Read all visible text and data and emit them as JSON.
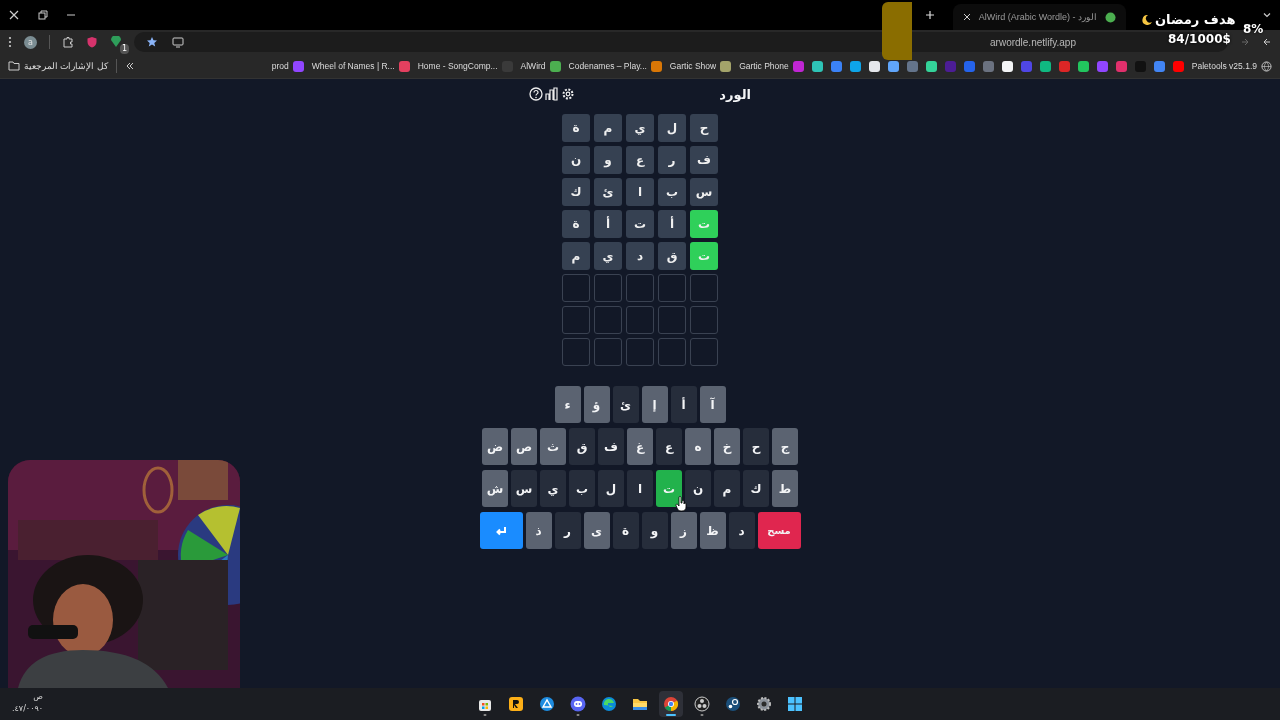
{
  "browser": {
    "tab": {
      "title": "AlWird (Arabic Wordle) - الورد"
    },
    "profile_initial": "a",
    "extension_badge": "1",
    "address": "arwordle.netlify.app",
    "extra_bookmark": "Paletools v25.1.9",
    "icon_bookmarks": [
      {
        "color": "#ff0000"
      },
      {
        "color": "#4285f4"
      },
      {
        "color": "#111111"
      },
      {
        "color": "#e1306c"
      },
      {
        "color": "#9146ff"
      },
      {
        "color": "#22c55e"
      },
      {
        "color": "#dc2626"
      },
      {
        "color": "#10b981"
      },
      {
        "color": "#4f46e5"
      },
      {
        "color": "#f3f4f6"
      },
      {
        "color": "#6b7280"
      },
      {
        "color": "#2563eb"
      },
      {
        "color": "#4c1d95"
      },
      {
        "color": "#34d399"
      },
      {
        "color": "#64748b"
      },
      {
        "color": "#60a5fa"
      },
      {
        "color": "#e5e7eb"
      },
      {
        "color": "#0ea5e9"
      },
      {
        "color": "#3b82f6"
      },
      {
        "color": "#2ec4b6"
      }
    ],
    "bookmarks": [
      {
        "label": "Gartic Phone",
        "color": "#c026d3"
      },
      {
        "label": "Gartic Show",
        "color": "#a3a36a"
      },
      {
        "label": "Codenames – Play...",
        "color": "#d97706"
      },
      {
        "label": "AlWird",
        "color": "#4caf50"
      },
      {
        "label": "Home - SongComp...",
        "color": "#3a3a3a"
      },
      {
        "label": "Wheel of Names | R...",
        "color": "#e4405f"
      },
      {
        "label": "prod",
        "color": "#9146ff"
      }
    ],
    "all_bookmarks": "كل الإشارات المرجعية"
  },
  "stream_overlay": {
    "goal_title": "هدف رمضان",
    "percent": "8%",
    "amount": "84/1000$"
  },
  "game": {
    "title": "الورد",
    "rows": [
      {
        "filled": true,
        "tiles": [
          {
            "letter": "ح",
            "correct": false
          },
          {
            "letter": "ل",
            "correct": false
          },
          {
            "letter": "ي",
            "correct": false
          },
          {
            "letter": "م",
            "correct": false
          },
          {
            "letter": "ة",
            "correct": false
          }
        ]
      },
      {
        "filled": true,
        "tiles": [
          {
            "letter": "ف",
            "correct": false
          },
          {
            "letter": "ر",
            "correct": false
          },
          {
            "letter": "ع",
            "correct": false
          },
          {
            "letter": "و",
            "correct": false
          },
          {
            "letter": "ن",
            "correct": false
          }
        ]
      },
      {
        "filled": true,
        "tiles": [
          {
            "letter": "س",
            "correct": false
          },
          {
            "letter": "ب",
            "correct": false
          },
          {
            "letter": "ا",
            "correct": false
          },
          {
            "letter": "ئ",
            "correct": false
          },
          {
            "letter": "ك",
            "correct": false
          }
        ]
      },
      {
        "filled": true,
        "tiles": [
          {
            "letter": "ت",
            "correct": true
          },
          {
            "letter": "أ",
            "correct": false
          },
          {
            "letter": "ت",
            "correct": false
          },
          {
            "letter": "أ",
            "correct": false
          },
          {
            "letter": "ة",
            "correct": false
          }
        ]
      },
      {
        "filled": true,
        "tiles": [
          {
            "letter": "ت",
            "correct": true
          },
          {
            "letter": "ق",
            "correct": false
          },
          {
            "letter": "د",
            "correct": false
          },
          {
            "letter": "ي",
            "correct": false
          },
          {
            "letter": "م",
            "correct": false
          }
        ]
      },
      {
        "filled": false
      },
      {
        "filled": false
      },
      {
        "filled": false
      }
    ]
  },
  "keyboard": {
    "rows": [
      [
        {
          "kind": "letter",
          "label": "آ",
          "used": false,
          "correct": false
        },
        {
          "kind": "letter",
          "label": "أ",
          "used": true,
          "correct": false
        },
        {
          "kind": "letter",
          "label": "إ",
          "used": false,
          "correct": false
        },
        {
          "kind": "letter",
          "label": "ئ",
          "used": true,
          "correct": false
        },
        {
          "kind": "letter",
          "label": "ؤ",
          "used": false,
          "correct": false
        },
        {
          "kind": "letter",
          "label": "ء",
          "used": false,
          "correct": false
        }
      ],
      [
        {
          "kind": "letter",
          "label": "ج",
          "used": false,
          "correct": false
        },
        {
          "kind": "letter",
          "label": "ح",
          "used": true,
          "correct": false
        },
        {
          "kind": "letter",
          "label": "خ",
          "used": false,
          "correct": false
        },
        {
          "kind": "letter",
          "label": "ه",
          "used": false,
          "correct": false
        },
        {
          "kind": "letter",
          "label": "ع",
          "used": true,
          "correct": false
        },
        {
          "kind": "letter",
          "label": "غ",
          "used": false,
          "correct": false
        },
        {
          "kind": "letter",
          "label": "ف",
          "used": true,
          "correct": false
        },
        {
          "kind": "letter",
          "label": "ق",
          "used": true,
          "correct": false
        },
        {
          "kind": "letter",
          "label": "ث",
          "used": false,
          "correct": false
        },
        {
          "kind": "letter",
          "label": "ص",
          "used": false,
          "correct": false
        },
        {
          "kind": "letter",
          "label": "ض",
          "used": false,
          "correct": false
        }
      ],
      [
        {
          "kind": "letter",
          "label": "ط",
          "used": false,
          "correct": false
        },
        {
          "kind": "letter",
          "label": "ك",
          "used": true,
          "correct": false
        },
        {
          "kind": "letter",
          "label": "م",
          "used": true,
          "correct": false
        },
        {
          "kind": "letter",
          "label": "ن",
          "used": true,
          "correct": false
        },
        {
          "kind": "letter",
          "label": "ت",
          "used": true,
          "correct": true
        },
        {
          "kind": "letter",
          "label": "ا",
          "used": true,
          "correct": false
        },
        {
          "kind": "letter",
          "label": "ل",
          "used": true,
          "correct": false
        },
        {
          "kind": "letter",
          "label": "ب",
          "used": true,
          "correct": false
        },
        {
          "kind": "letter",
          "label": "ي",
          "used": true,
          "correct": false
        },
        {
          "kind": "letter",
          "label": "س",
          "used": true,
          "correct": false
        },
        {
          "kind": "letter",
          "label": "ش",
          "used": false,
          "correct": false
        }
      ],
      [
        {
          "kind": "delete",
          "label": "مسح"
        },
        {
          "kind": "letter",
          "label": "د",
          "used": true,
          "correct": false
        },
        {
          "kind": "letter",
          "label": "ظ",
          "used": false,
          "correct": false
        },
        {
          "kind": "letter",
          "label": "ز",
          "used": false,
          "correct": false
        },
        {
          "kind": "letter",
          "label": "و",
          "used": true,
          "correct": false
        },
        {
          "kind": "letter",
          "label": "ة",
          "used": true,
          "correct": false
        },
        {
          "kind": "letter",
          "label": "ى",
          "used": false,
          "correct": false
        },
        {
          "kind": "letter",
          "label": "ر",
          "used": true,
          "correct": false
        },
        {
          "kind": "letter",
          "label": "ذ",
          "used": false,
          "correct": false
        },
        {
          "kind": "enter"
        }
      ]
    ]
  },
  "taskbar": {
    "clock": [
      "ص",
      "٤٧/٠٠٩٠."
    ],
    "apps": [
      {
        "kind": "store",
        "active": false,
        "running": true
      },
      {
        "kind": "rockstar",
        "active": false,
        "running": false
      },
      {
        "kind": "copilot",
        "active": false,
        "running": false
      },
      {
        "kind": "discord",
        "active": false,
        "running": true
      },
      {
        "kind": "edge",
        "active": false,
        "running": false
      },
      {
        "kind": "folder",
        "active": false,
        "running": false
      },
      {
        "kind": "chrome",
        "active": true,
        "running": true
      },
      {
        "kind": "obs",
        "active": false,
        "running": true
      },
      {
        "kind": "steam",
        "active": false,
        "running": false
      },
      {
        "kind": "settings",
        "active": false,
        "running": false
      },
      {
        "kind": "start",
        "active": false,
        "running": false
      }
    ]
  }
}
